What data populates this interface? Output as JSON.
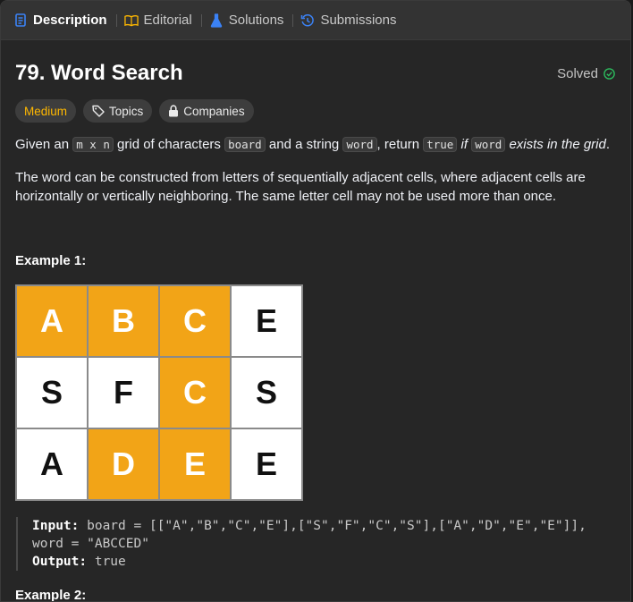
{
  "tabs": [
    {
      "label": "Description",
      "icon": "description-icon",
      "color": "#3b82f6"
    },
    {
      "label": "Editorial",
      "icon": "book-icon",
      "color": "#ffb800"
    },
    {
      "label": "Solutions",
      "icon": "flask-icon",
      "color": "#3b82f6"
    },
    {
      "label": "Submissions",
      "icon": "history-icon",
      "color": "#3b82f6"
    }
  ],
  "problem": {
    "title": "79. Word Search",
    "status": "Solved",
    "badges": {
      "difficulty": "Medium",
      "topics": "Topics",
      "companies": "Companies"
    }
  },
  "description": {
    "p1": {
      "t1": "Given an ",
      "c1": "m x n",
      "t2": " grid of characters ",
      "c2": "board",
      "t3": " and a string ",
      "c3": "word",
      "t4": ", return ",
      "c4": "true",
      "t5": " if ",
      "c5": "word",
      "t6": " exists in the grid",
      "t7": "."
    },
    "p2": "The word can be constructed from letters of sequentially adjacent cells, where adjacent cells are horizontally or vertically neighboring. The same letter cell may not be used more than once."
  },
  "example1": {
    "title": "Example 1:",
    "grid": [
      [
        {
          "ch": "A",
          "hl": true
        },
        {
          "ch": "B",
          "hl": true
        },
        {
          "ch": "C",
          "hl": true
        },
        {
          "ch": "E",
          "hl": false
        }
      ],
      [
        {
          "ch": "S",
          "hl": false
        },
        {
          "ch": "F",
          "hl": false
        },
        {
          "ch": "C",
          "hl": true
        },
        {
          "ch": "S",
          "hl": false
        }
      ],
      [
        {
          "ch": "A",
          "hl": false
        },
        {
          "ch": "D",
          "hl": true
        },
        {
          "ch": "E",
          "hl": true
        },
        {
          "ch": "E",
          "hl": false
        }
      ]
    ],
    "input_label": "Input:",
    "input_value": " board = [[\"A\",\"B\",\"C\",\"E\"],[\"S\",\"F\",\"C\",\"S\"],[\"A\",\"D\",\"E\",\"E\"]], word = \"ABCCED\"",
    "output_label": "Output:",
    "output_value": " true"
  },
  "example2": {
    "title": "Example 2:"
  },
  "colors": {
    "highlight": "#f2a417",
    "medium": "#ffb800",
    "solved": "#2cbb5d"
  }
}
